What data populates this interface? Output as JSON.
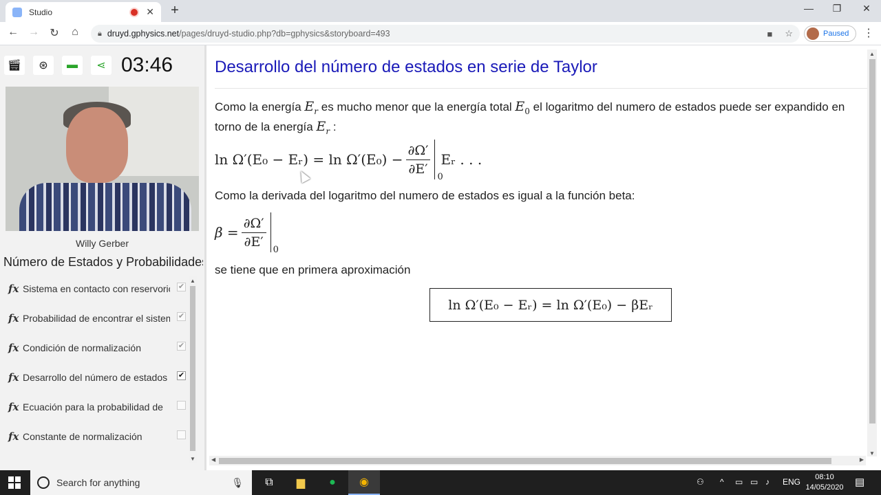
{
  "browser": {
    "tab_title": "Studio",
    "new_tab": "+",
    "url_host": "druyd.gphysics.net",
    "url_path": "/pages/druyd-studio.php?db=gphysics&storyboard=493",
    "profile_label": "Paused",
    "window_controls": [
      "—",
      "❐",
      "✕"
    ]
  },
  "player": {
    "timer": "03:46",
    "controls": [
      "clapperboard-icon",
      "film-reel-icon",
      "screen-icon",
      "share-icon"
    ],
    "presenter": "Willy Gerber"
  },
  "sidebar": {
    "section_title": "Número de Estados y Probabilidades",
    "items": [
      {
        "fx": "fx",
        "label": "Sistema en contacto con reservorio",
        "checked": "light"
      },
      {
        "fx": "fx",
        "label": "Probabilidad de encontrar el sistema",
        "checked": "light"
      },
      {
        "fx": "fx",
        "label": "Condición de normalización",
        "checked": "light"
      },
      {
        "fx": "fx",
        "label": "Desarrollo del número de estados",
        "checked": "dark"
      },
      {
        "fx": "fx",
        "label": "Ecuación para la probabilidad de",
        "checked": "none"
      },
      {
        "fx": "fx",
        "label": "Constante de normalización",
        "checked": "none"
      }
    ]
  },
  "content": {
    "title": "Desarrollo del número de estados en serie de Taylor",
    "p1_a": "Como la energía",
    "p1_Er": "E",
    "p1_r": "r",
    "p1_b": "es mucho menor que la energía total",
    "p1_E0": "E",
    "p1_0": "0",
    "p1_c": "el logaritmo del numero de estados puede ser expandido en torno de la energía",
    "p1_end": ":",
    "eq1_lhs": "ln Ω′(E₀ − Eᵣ) = ln Ω′(E₀) −",
    "eq1_num": "∂Ω′",
    "eq1_den": "∂E′",
    "eq1_sub": "0",
    "eq1_tail": "Eᵣ . . .",
    "p2": "Como la derivada del logaritmo del numero de estados es igual a la función beta:",
    "eq2_lhs": "β =",
    "eq2_num": "∂Ω′",
    "eq2_den": "∂E′",
    "eq2_sub": "0",
    "p3": "se tiene que en primera aproximación",
    "boxed_eq": "ln Ω′(E₀ − Eᵣ) = ln Ω′(E₀) − βEᵣ"
  },
  "taskbar": {
    "search_placeholder": "Search for anything",
    "language": "ENG",
    "time": "08:10",
    "date": "14/05/2020"
  }
}
